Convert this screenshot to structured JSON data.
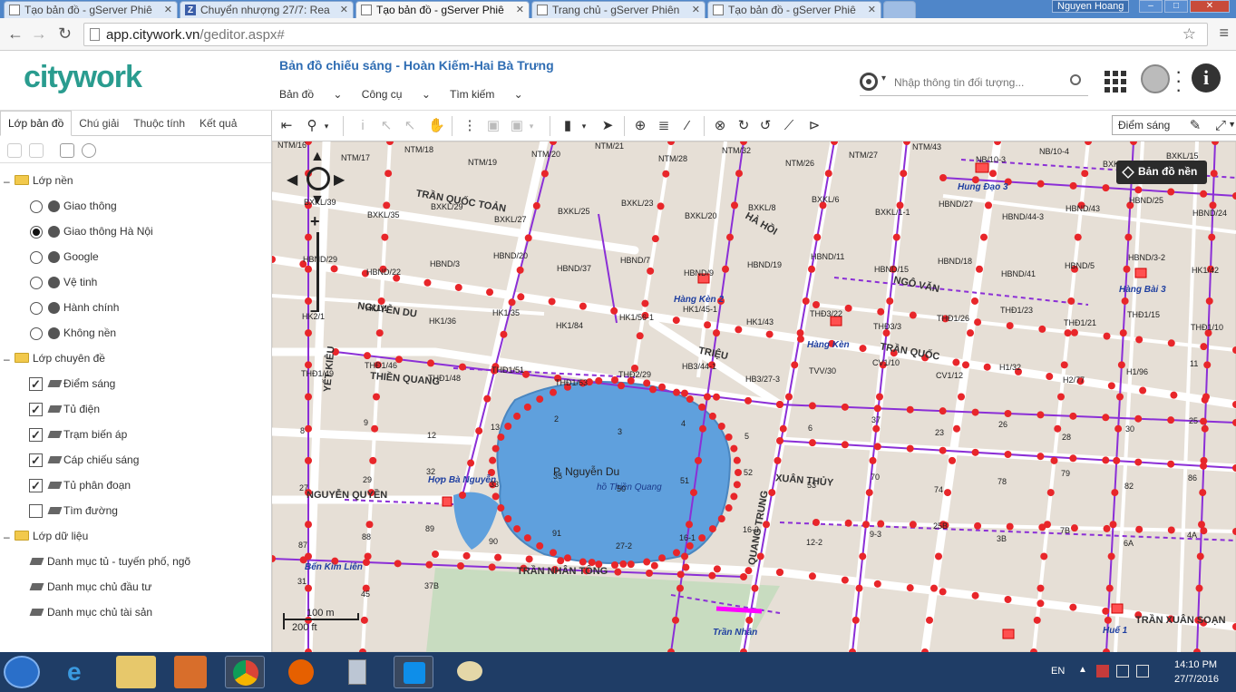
{
  "browser": {
    "tabs": [
      {
        "title": "Tạo bản đồ - gServer Phiê",
        "active": false
      },
      {
        "title": "Chuyển nhượng 27/7: Rea",
        "active": false
      },
      {
        "title": "Tạo bản đồ - gServer Phiê",
        "active": true
      },
      {
        "title": "Trang chủ - gServer Phiên",
        "active": false
      },
      {
        "title": "Tạo bản đồ - gServer Phiê",
        "active": false
      }
    ],
    "user": "Nguyen Hoang",
    "url_host": "app.citywork.vn",
    "url_path": "/geditor.aspx#"
  },
  "app": {
    "logo": "citywork",
    "title": "Bản đồ chiếu sáng - Hoàn Kiếm-Hai Bà Trưng",
    "menu": [
      "Bản đồ",
      "Công cụ",
      "Tìm kiếm"
    ],
    "search_placeholder": "Nhập thông tin đối tượng..."
  },
  "left_panel": {
    "tabs": [
      "Lớp bản đồ",
      "Chú giải",
      "Thuộc tính",
      "Kết quả"
    ],
    "groups": [
      {
        "label": "Lớp nền",
        "items": [
          {
            "label": "Giao thông",
            "checked": false
          },
          {
            "label": "Giao thông Hà Nội",
            "checked": true
          },
          {
            "label": "Google",
            "checked": false
          },
          {
            "label": "Vệ tinh",
            "checked": false
          },
          {
            "label": "Hành chính",
            "checked": false
          },
          {
            "label": "Không nền",
            "checked": false
          }
        ]
      },
      {
        "label": "Lớp chuyên đề",
        "items": [
          {
            "label": "Điểm sáng",
            "checked": true
          },
          {
            "label": "Tủ điện",
            "checked": true
          },
          {
            "label": "Trạm biến áp",
            "checked": true
          },
          {
            "label": "Cáp chiếu sáng",
            "checked": true
          },
          {
            "label": "Tủ phân đoạn",
            "checked": true
          },
          {
            "label": "Tìm đường",
            "checked": false
          }
        ]
      },
      {
        "label": "Lớp dữ liệu",
        "items": [
          {
            "label": "Danh mục tủ - tuyến phố, ngõ"
          },
          {
            "label": "Danh mục chủ đầu tư"
          },
          {
            "label": "Danh mục chủ tài sản"
          }
        ]
      }
    ]
  },
  "toolbar": {
    "layer_select": "Điểm sáng"
  },
  "map": {
    "basemap_button": "Bản đồ nền",
    "lake_name": "P. Nguyễn Du",
    "lake_label": "hồ Thiền Quang",
    "scale_m": "100 m",
    "scale_ft": "200 ft",
    "street_labels": [
      "NGUYỄN DU",
      "TRẦN QUỐC TOẢN",
      "THIỀN QUANG",
      "NGUYỄN QUYỀN",
      "TRẦN NHÂN TÔNG",
      "XUÂN THỦY",
      "QUANG TRUNG",
      "TRẦN XUÂN SOẠN",
      "TRIỆU",
      "TRẦN QUỐC",
      "NGÔ VĂN",
      "YẾT KIÊU",
      "HÀ HỒI"
    ],
    "place_labels": [
      "Hàng Kèn 2",
      "Hàng Kèn",
      "Hợp Bà Nguyễn",
      "Bến Kim Liên",
      "Trần Nhân",
      "Hàng Bài 3",
      "Hung Đạo 3",
      "Huế 1"
    ],
    "code_labels": [
      "NTM/16",
      "NTM/17",
      "NTM/18",
      "NTM/19",
      "NTM/20",
      "NTM/21",
      "NTM/28",
      "NTM/32",
      "NTM/26",
      "NTM/27",
      "NTM/43",
      "NB/10-3",
      "NB/10-4",
      "BXKL/17",
      "BXKL/15",
      "BXKL/39",
      "BXKL/35",
      "BXKL/29",
      "BXKL/27",
      "BXKL/25",
      "BXKL/23",
      "BXKL/20",
      "BXKL/8",
      "BXKL/6",
      "BXKL/1-1",
      "HBND/27",
      "HBND/44-3",
      "HBND/43",
      "HBND/25",
      "HBND/24",
      "HBND/29",
      "HBND/22",
      "HBND/3",
      "HBND/20",
      "HBND/37",
      "HBND/7",
      "HBND/9",
      "HBND/19",
      "HBND/11",
      "HBND/15",
      "HBND/18",
      "HBND/41",
      "HBND/5",
      "HBND/3-2",
      "HK1/42",
      "HK2/1",
      "HK1/1",
      "HK1/36",
      "HK1/35",
      "HK1/84",
      "HK1/56-1",
      "HK1/45-1",
      "HK1/43",
      "THĐ3/22",
      "THĐ3/3",
      "THĐ1/26",
      "THĐ1/23",
      "THĐ1/21",
      "THĐ1/15",
      "THĐ1/10",
      "THĐ1/49",
      "THĐ1/46",
      "THĐ1/48",
      "THĐ1/51",
      "THĐ1/53",
      "THĐ2/29",
      "HB3/44-1",
      "HB3/27-3",
      "TVV/30",
      "CV1/10",
      "CV1/12",
      "H1/32",
      "H2/77",
      "H1/96",
      "11",
      "8",
      "9",
      "12",
      "13",
      "2",
      "3",
      "4",
      "5",
      "6",
      "37",
      "23",
      "26",
      "28",
      "30",
      "25",
      "27",
      "29",
      "32",
      "33",
      "35",
      "50",
      "51",
      "52",
      "53",
      "70",
      "74",
      "78",
      "79",
      "82",
      "86",
      "87",
      "88",
      "89",
      "90",
      "91",
      "27-2",
      "16-1",
      "16-2",
      "12-2",
      "9-3",
      "25B",
      "3B",
      "7B",
      "6A",
      "4A",
      "31",
      "45",
      "37B"
    ]
  },
  "taskbar": {
    "lang": "EN",
    "time": "14:10 PM",
    "date": "27/7/2016"
  },
  "colors": {
    "accent": "#2f6db3",
    "logo": "#2a9c8f",
    "light_point": "#e8262a",
    "cable": "#8b2fd6",
    "lake": "#5fa0dd",
    "taskbar": "#1f3d66"
  }
}
